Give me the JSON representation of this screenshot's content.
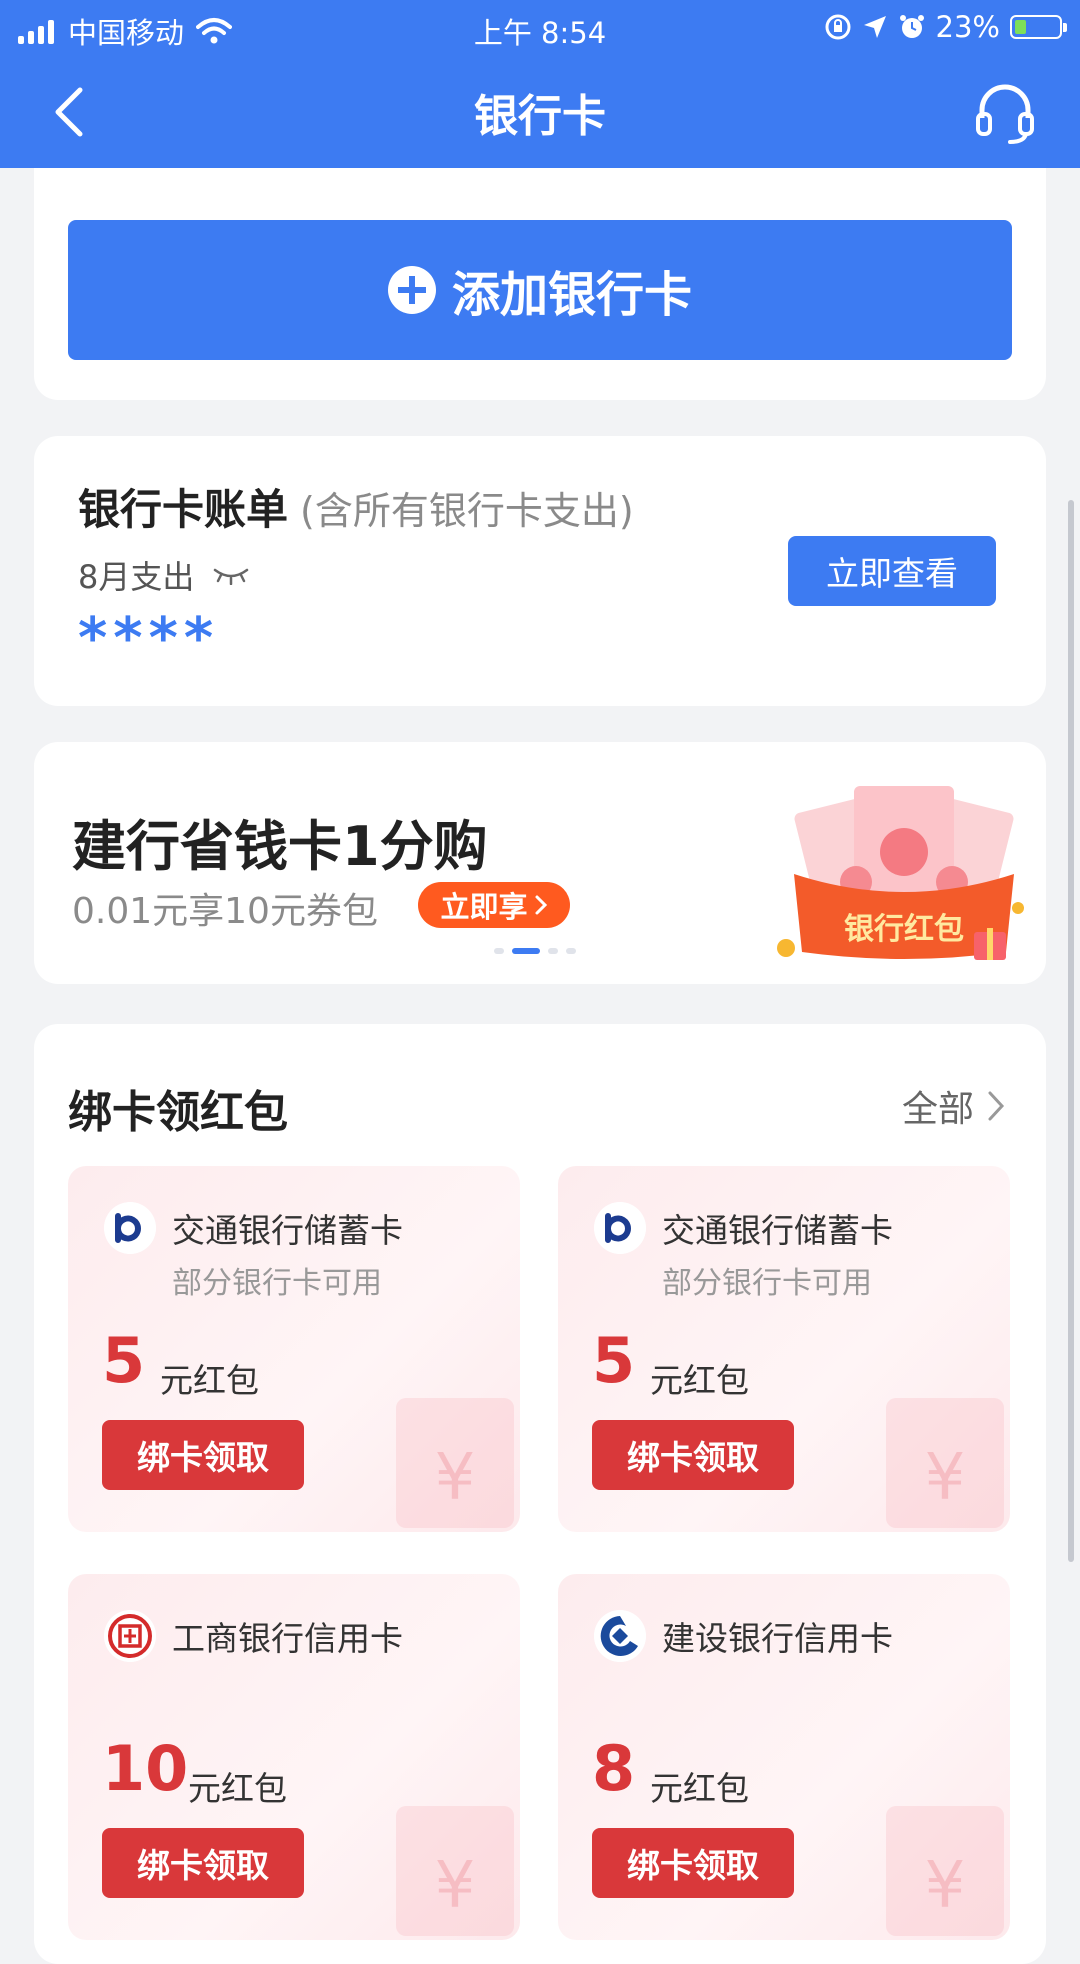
{
  "status_bar": {
    "carrier": "中国移动",
    "time": "上午 8:54",
    "battery_percent": "23%",
    "icons": [
      "signal-icon",
      "wifi-icon",
      "orientation-lock-icon",
      "location-icon",
      "alarm-icon",
      "battery-charging-icon"
    ]
  },
  "nav": {
    "title": "银行卡",
    "back_icon": "chevron-left-icon",
    "service_icon": "headset-icon"
  },
  "add_card": {
    "label": "添加银行卡",
    "icon": "plus-circle-icon"
  },
  "bill": {
    "title": "银行卡账单",
    "note": "(含所有银行卡支出)",
    "month_label": "8月支出",
    "amount_masked": "****",
    "view_button": "立即查看",
    "eye_icon": "eye-closed-icon"
  },
  "promo": {
    "title": "建行省钱卡1分购",
    "subtitle": "0.01元享10元券包",
    "button": "立即享",
    "illustration_label": "银行红包",
    "carousel_total": 4,
    "carousel_active_index": 1
  },
  "rewards": {
    "title": "绑卡领红包",
    "all_label": "全部",
    "items": [
      {
        "bank": "交通银行储蓄卡",
        "note": "部分银行卡可用",
        "amount": "5",
        "unit": "元红包",
        "button": "绑卡领取",
        "logo": "bocom-logo-icon"
      },
      {
        "bank": "交通银行储蓄卡",
        "note": "部分银行卡可用",
        "amount": "5",
        "unit": "元红包",
        "button": "绑卡领取",
        "logo": "bocom-logo-icon"
      },
      {
        "bank": "工商银行信用卡",
        "note": "",
        "amount": "10",
        "unit": "元红包",
        "button": "绑卡领取",
        "logo": "icbc-logo-icon"
      },
      {
        "bank": "建设银行信用卡",
        "note": "",
        "amount": "8",
        "unit": "元红包",
        "button": "绑卡领取",
        "logo": "ccb-logo-icon"
      }
    ],
    "decoration_symbol": "¥"
  },
  "colors": {
    "primary": "#3d7bf2",
    "reward_red": "#d9383a",
    "promo_orange": "#ff5a1f",
    "page_bg": "#f2f3f5"
  }
}
